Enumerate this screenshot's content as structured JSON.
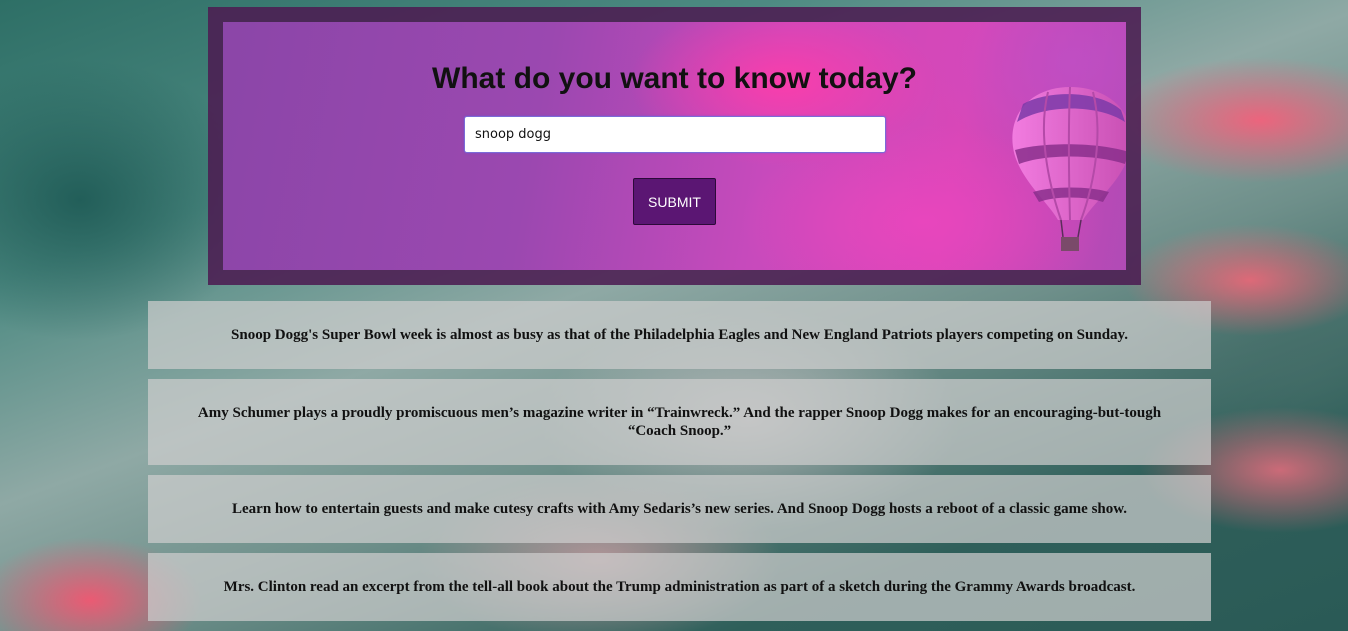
{
  "hero": {
    "title": "What do you want to know today?",
    "search_value": "snoop dogg",
    "submit_label": "SUBMIT",
    "balloon_icon": "hot-air-balloon-icon"
  },
  "results": [
    {
      "text": "Snoop Dogg's Super Bowl week is almost as busy as that of the Philadelphia Eagles and New England Patriots players competing on Sunday."
    },
    {
      "text": "Amy Schumer plays a proudly promiscuous men’s magazine writer in “Trainwreck.” And the rapper Snoop Dogg makes for an encouraging-but-tough “Coach Snoop.”"
    },
    {
      "text": "Learn how to entertain guests and make cutesy crafts with Amy Sedaris’s new series. And Snoop Dogg hosts a reboot of a classic game show."
    },
    {
      "text": "Mrs. Clinton read an excerpt from the tell-all book about the Trump administration as part of a sketch during the Grammy Awards broadcast."
    }
  ],
  "colors": {
    "frame": "#4c1c52",
    "button": "#5b1673",
    "card": "#cdcdcd"
  }
}
